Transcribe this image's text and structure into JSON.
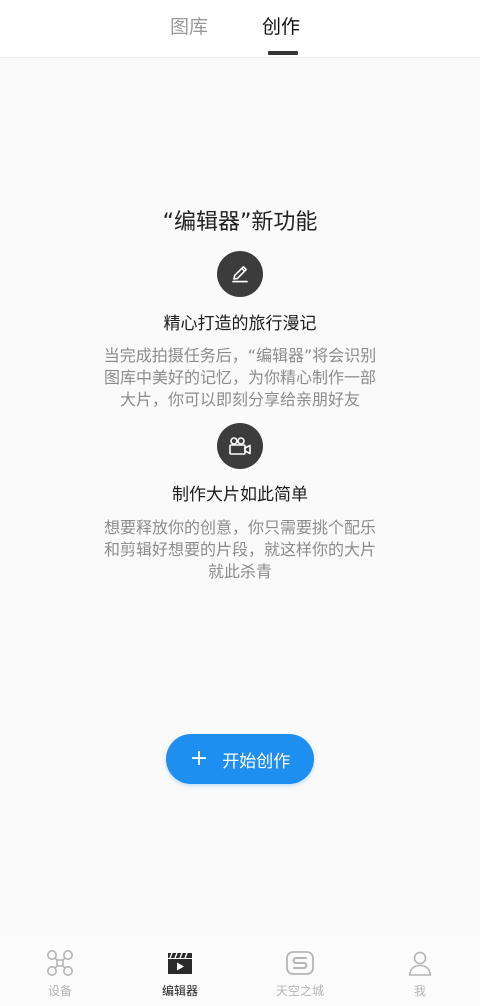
{
  "top_tabs": {
    "gallery": "图库",
    "create": "创作"
  },
  "feature": {
    "title": "“编辑器”新功能",
    "items": [
      {
        "icon": "pencil-icon",
        "heading": "精心打造的旅行漫记",
        "lines": [
          "当完成拍摄任务后，“编辑器”将会识别",
          "图库中美好的记忆，为你精心制作一部",
          "大片，你可以即刻分享给亲朋好友"
        ]
      },
      {
        "icon": "video-camera-icon",
        "heading": "制作大片如此简单",
        "lines": [
          "想要释放你的创意，你只需要挑个配乐",
          "和剪辑好想要的片段，就这样你的大片",
          "就此杀青"
        ]
      }
    ]
  },
  "start_button": {
    "icon": "plus-icon",
    "label": "开始创作"
  },
  "bottom_nav": {
    "active_index": 1,
    "items": [
      {
        "icon": "drone-icon",
        "label": "设备"
      },
      {
        "icon": "clapperboard-icon",
        "label": "编辑器"
      },
      {
        "icon": "skypixel-logo-icon",
        "label": "天空之城"
      },
      {
        "icon": "person-icon",
        "label": "我"
      }
    ]
  },
  "colors": {
    "accent": "#1f8ef1",
    "icon_circle": "#3c3c3c",
    "muted_text": "#8c8c8c",
    "inactive_tab": "#9a9a9a"
  }
}
